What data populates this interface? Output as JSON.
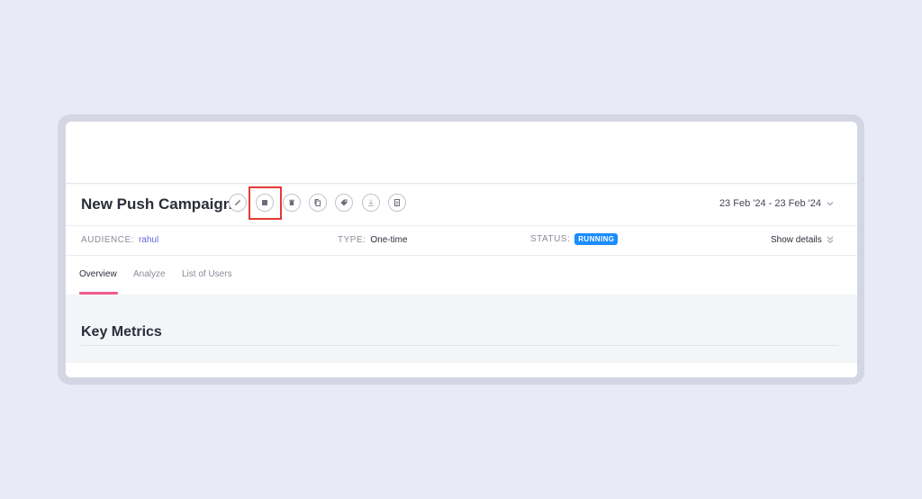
{
  "campaign": {
    "title": "New Push Campaign",
    "date_range": "23 Feb '24 - 23 Feb '24"
  },
  "actions": [
    {
      "name": "edit-icon"
    },
    {
      "name": "stop-icon"
    },
    {
      "name": "delete-icon"
    },
    {
      "name": "duplicate-icon"
    },
    {
      "name": "tag-icon"
    },
    {
      "name": "download-icon"
    },
    {
      "name": "report-icon"
    }
  ],
  "meta": {
    "audience_label": "AUDIENCE:",
    "audience_value": "rahul",
    "type_label": "TYPE:",
    "type_value": "One-time",
    "status_label": "STATUS:",
    "status_value": "RUNNING",
    "show_details": "Show details"
  },
  "tabs": [
    {
      "label": "Overview",
      "active": true
    },
    {
      "label": "Analyze",
      "active": false
    },
    {
      "label": "List of Users",
      "active": false
    }
  ],
  "section": {
    "title": "Key Metrics"
  },
  "colors": {
    "background": "#e9eaf8",
    "status_badge": "#1a8cff",
    "active_tab_underline": "#ef5a8e",
    "highlight_box": "#e53935",
    "audience_link": "#5b6bd6"
  }
}
